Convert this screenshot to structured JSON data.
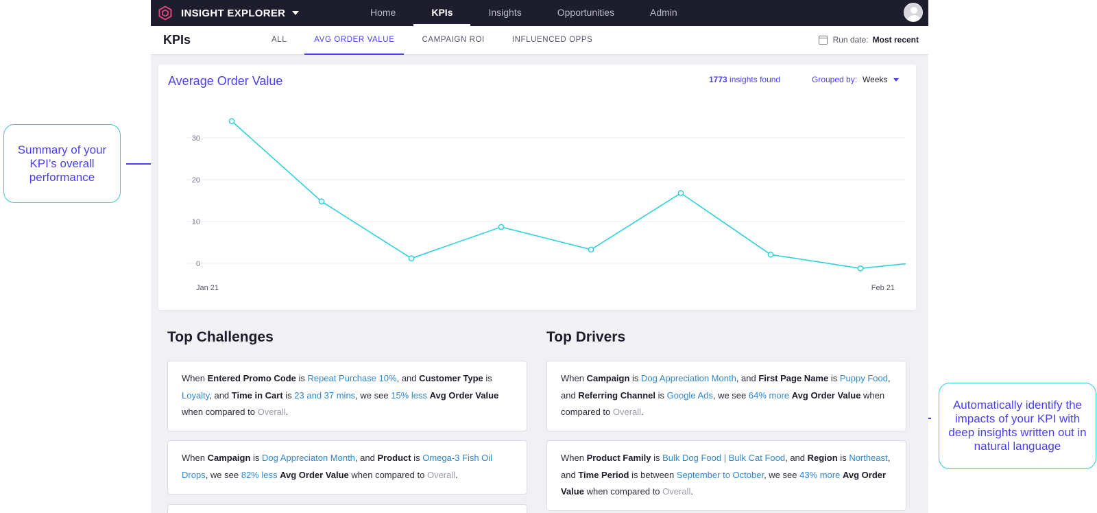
{
  "annotations": {
    "left": "Summary of your KPI’s overall performance",
    "right": "Automatically identify the impacts of your KPI with deep insights written out in natural language"
  },
  "brand": {
    "name": "INSIGHT EXPLORER",
    "logo_icon": "hexagon-logo-icon"
  },
  "nav": {
    "items": [
      "Home",
      "KPIs",
      "Insights",
      "Opportunities",
      "Admin"
    ],
    "active": "KPIs"
  },
  "subnav": {
    "title": "KPIs",
    "tabs": [
      "ALL",
      "AVG ORDER VALUE",
      "CAMPAIGN ROI",
      "INFLUENCED OPPS"
    ],
    "active_tab": "AVG ORDER VALUE",
    "run_date_label": "Run date:",
    "run_date_value": "Most recent"
  },
  "kpi_card": {
    "title": "Average Order Value",
    "insights_count": "1773",
    "insights_suffix": "insights found",
    "grouped_label": "Grouped by:",
    "grouped_value": "Weeks"
  },
  "chart_data": {
    "type": "line",
    "title": "Average Order Value",
    "x_tick_labels": [
      "Jan 21",
      "Feb 21"
    ],
    "y_ticks": [
      0,
      10,
      20,
      30
    ],
    "ylim": [
      -3,
      36
    ],
    "grid": true,
    "legend": "none",
    "series": [
      {
        "color": "#2fd0dc",
        "values": [
          34,
          14.8,
          1.2,
          8.7,
          3.3,
          16.8,
          2.1,
          -1.2,
          1
        ]
      }
    ]
  },
  "challenges": {
    "title": "Top Challenges",
    "items": [
      [
        {
          "t": "When ",
          "s": "p"
        },
        {
          "t": "Entered Promo Code",
          "s": "b"
        },
        {
          "t": " is ",
          "s": "p"
        },
        {
          "t": "Repeat Purchase 10%",
          "s": "hl"
        },
        {
          "t": ", and ",
          "s": "p"
        },
        {
          "t": "Customer Type",
          "s": "b"
        },
        {
          "t": " is ",
          "s": "p"
        },
        {
          "t": "Loyalty",
          "s": "hl"
        },
        {
          "t": ", and ",
          "s": "p"
        },
        {
          "t": "Time in Cart",
          "s": "b"
        },
        {
          "t": " is ",
          "s": "p"
        },
        {
          "t": "23 and 37 mins",
          "s": "hl"
        },
        {
          "t": ", we see ",
          "s": "p"
        },
        {
          "t": "15% less",
          "s": "hl"
        },
        {
          "t": " ",
          "s": "p"
        },
        {
          "t": "Avg Order Value",
          "s": "b"
        },
        {
          "t": " when compared to ",
          "s": "p"
        },
        {
          "t": "Overall",
          "s": "ov"
        },
        {
          "t": ".",
          "s": "p"
        }
      ],
      [
        {
          "t": "When ",
          "s": "p"
        },
        {
          "t": "Campaign",
          "s": "b"
        },
        {
          "t": " is ",
          "s": "p"
        },
        {
          "t": "Dog Appreciaton Month",
          "s": "hl"
        },
        {
          "t": ", and ",
          "s": "p"
        },
        {
          "t": "Product",
          "s": "b"
        },
        {
          "t": " is ",
          "s": "p"
        },
        {
          "t": "Omega-3 Fish Oil Drops",
          "s": "hl"
        },
        {
          "t": ", we see ",
          "s": "p"
        },
        {
          "t": "82% less",
          "s": "hl"
        },
        {
          "t": " ",
          "s": "p"
        },
        {
          "t": "Avg Order Value",
          "s": "b"
        },
        {
          "t": " when compared to ",
          "s": "p"
        },
        {
          "t": "Overall",
          "s": "ov"
        },
        {
          "t": ".",
          "s": "p"
        }
      ]
    ]
  },
  "drivers": {
    "title": "Top Drivers",
    "items": [
      [
        {
          "t": "When ",
          "s": "p"
        },
        {
          "t": "Campaign",
          "s": "b"
        },
        {
          "t": " is ",
          "s": "p"
        },
        {
          "t": "Dog Appreciation Month",
          "s": "hl"
        },
        {
          "t": ", and ",
          "s": "p"
        },
        {
          "t": "First Page Name",
          "s": "b"
        },
        {
          "t": " is ",
          "s": "p"
        },
        {
          "t": "Puppy Food",
          "s": "hl"
        },
        {
          "t": ", and ",
          "s": "p"
        },
        {
          "t": "Referring Channel",
          "s": "b"
        },
        {
          "t": " is ",
          "s": "p"
        },
        {
          "t": "Google Ads",
          "s": "hl"
        },
        {
          "t": ", we see ",
          "s": "p"
        },
        {
          "t": "64% more",
          "s": "hl"
        },
        {
          "t": " ",
          "s": "p"
        },
        {
          "t": "Avg Order Value",
          "s": "b"
        },
        {
          "t": " when compared to ",
          "s": "p"
        },
        {
          "t": "Overall",
          "s": "ov"
        },
        {
          "t": ".",
          "s": "p"
        }
      ],
      [
        {
          "t": "When ",
          "s": "p"
        },
        {
          "t": "Product Family",
          "s": "b"
        },
        {
          "t": " is ",
          "s": "p"
        },
        {
          "t": "Bulk Dog Food | Bulk Cat Food",
          "s": "hl"
        },
        {
          "t": ", and ",
          "s": "p"
        },
        {
          "t": "Region",
          "s": "b"
        },
        {
          "t": " is ",
          "s": "p"
        },
        {
          "t": "Northeast",
          "s": "hl"
        },
        {
          "t": ", and ",
          "s": "p"
        },
        {
          "t": "Time Period",
          "s": "b"
        },
        {
          "t": " is between ",
          "s": "p"
        },
        {
          "t": "September to October",
          "s": "hl"
        },
        {
          "t": ", we see ",
          "s": "p"
        },
        {
          "t": "43% more",
          "s": "hl"
        },
        {
          "t": " ",
          "s": "p"
        },
        {
          "t": "Avg Order Value",
          "s": "b"
        },
        {
          "t": " when compared to ",
          "s": "p"
        },
        {
          "t": "Overall",
          "s": "ov"
        },
        {
          "t": ".",
          "s": "p"
        }
      ]
    ]
  },
  "colors": {
    "accent": "#4a3ff0",
    "line": "#2fd0dc",
    "link": "#2f86c9",
    "topbar": "#1e1d2e",
    "logo": "#e0457b"
  }
}
